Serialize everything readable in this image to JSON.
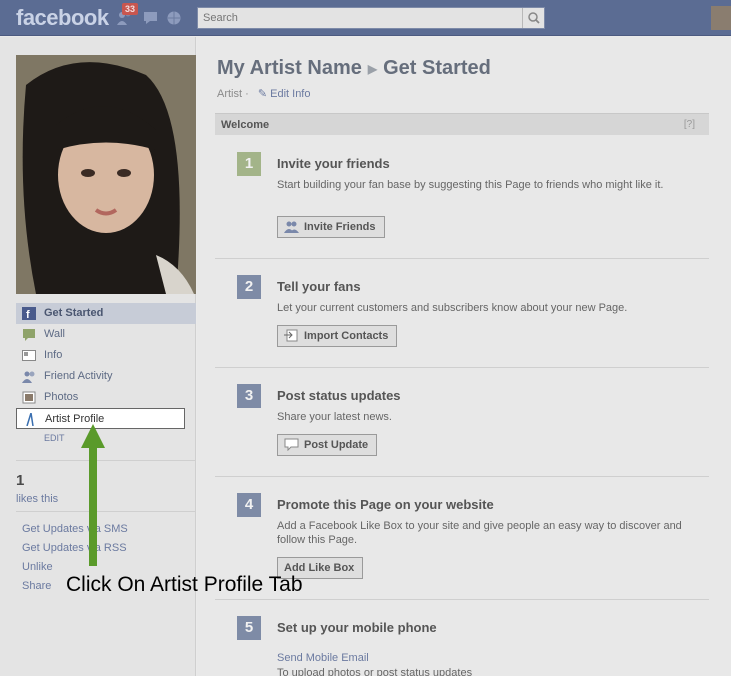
{
  "topbar": {
    "logo": "facebook",
    "notification_count": "33",
    "search_placeholder": "Search"
  },
  "sidebar": {
    "nav_items": [
      {
        "label": "Get Started",
        "icon": "facebook-icon"
      },
      {
        "label": "Wall",
        "icon": "wall-icon"
      },
      {
        "label": "Info",
        "icon": "info-icon"
      },
      {
        "label": "Friend Activity",
        "icon": "friends-icon"
      },
      {
        "label": "Photos",
        "icon": "photos-icon"
      },
      {
        "label": "Artist Profile",
        "icon": "artist-profile-icon"
      }
    ],
    "edit_label": "EDIT",
    "likes_count": "1",
    "likes_label": "likes this",
    "links": [
      "Get Updates via SMS",
      "Get Updates via RSS",
      "Unlike",
      "Share"
    ]
  },
  "main": {
    "page_name": "My Artist Name",
    "section": "Get Started",
    "category": "Artist ·",
    "edit_info": "Edit Info",
    "welcome": "Welcome",
    "help": "[?]",
    "steps": [
      {
        "num": "1",
        "title": "Invite your friends",
        "desc": "Start building your fan base by suggesting this Page to friends who might like it.",
        "button": "Invite Friends"
      },
      {
        "num": "2",
        "title": "Tell your fans",
        "desc": "Let your current customers and subscribers know about your new Page.",
        "button": "Import Contacts"
      },
      {
        "num": "3",
        "title": "Post status updates",
        "desc": "Share your latest news.",
        "button": "Post Update"
      },
      {
        "num": "4",
        "title": "Promote this Page on your website",
        "desc": "Add a Facebook Like Box to your site and give people an easy way to discover and follow this Page.",
        "button": "Add Like Box"
      },
      {
        "num": "5",
        "title": "Set up your mobile phone",
        "link": "Send Mobile Email",
        "desc": "To upload photos or post status updates"
      }
    ]
  },
  "annotation": "Click On Artist Profile Tab",
  "colors": {
    "topbar": "#5b6c93",
    "link": "#6b7aa0",
    "arrow": "#5a9a2a",
    "step_active": "#a3b489",
    "step": "#7e8ba6"
  }
}
